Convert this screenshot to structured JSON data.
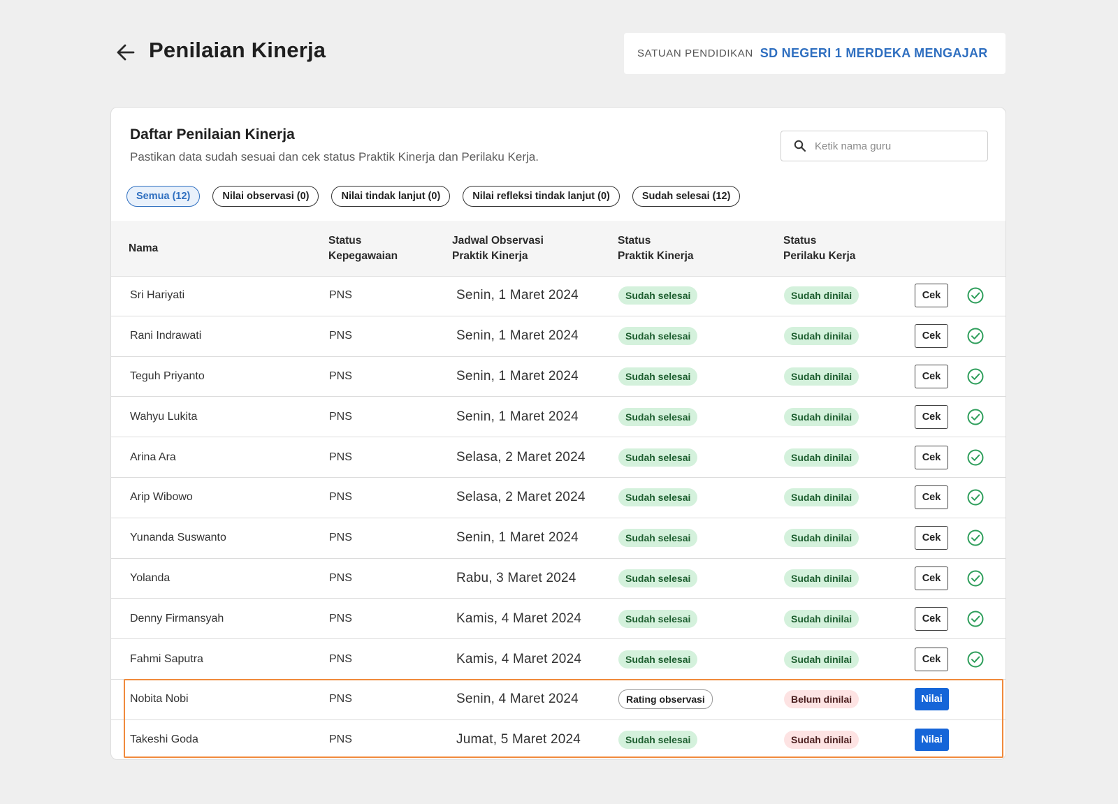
{
  "header": {
    "title": "Penilaian Kinerja",
    "school_label": "SATUAN PENDIDIKAN",
    "school_name": "SD NEGERI 1 MERDEKA MENGAJAR"
  },
  "card": {
    "title": "Daftar Penilaian Kinerja",
    "subtitle": "Pastikan data sudah sesuai dan cek status Praktik Kinerja dan Perilaku Kerja."
  },
  "search": {
    "placeholder": "Ketik nama guru"
  },
  "filters": [
    {
      "label": "Semua (12)",
      "active": true
    },
    {
      "label": "Nilai observasi (0)",
      "active": false
    },
    {
      "label": "Nilai tindak lanjut (0)",
      "active": false
    },
    {
      "label": "Nilai refleksi tindak lanjut (0)",
      "active": false
    },
    {
      "label": "Sudah selesai (12)",
      "active": false
    }
  ],
  "table": {
    "headers": {
      "nama": "Nama",
      "status_kepegawaian_1": "Status",
      "status_kepegawaian_2": "Kepegawaian",
      "jadwal_1": "Jadwal Observasi",
      "jadwal_2": "Praktik Kinerja",
      "praktik_1": "Status",
      "praktik_2": "Praktik Kinerja",
      "perilaku_1": "Status",
      "perilaku_2": "Perilaku Kerja"
    },
    "rows": [
      {
        "name": "Sri Hariyati",
        "employment": "PNS",
        "date": "Senin, 1 Maret 2024",
        "praktik": "Sudah selesai",
        "praktik_style": "green",
        "perilaku": "Sudah dinilai",
        "perilaku_style": "green",
        "action": "Cek",
        "checked": true
      },
      {
        "name": "Rani Indrawati",
        "employment": "PNS",
        "date": "Senin, 1 Maret 2024",
        "praktik": "Sudah selesai",
        "praktik_style": "green",
        "perilaku": "Sudah dinilai",
        "perilaku_style": "green",
        "action": "Cek",
        "checked": true
      },
      {
        "name": "Teguh Priyanto",
        "employment": "PNS",
        "date": "Senin, 1 Maret 2024",
        "praktik": "Sudah selesai",
        "praktik_style": "green",
        "perilaku": "Sudah dinilai",
        "perilaku_style": "green",
        "action": "Cek",
        "checked": true
      },
      {
        "name": "Wahyu Lukita",
        "employment": "PNS",
        "date": "Senin, 1 Maret 2024",
        "praktik": "Sudah selesai",
        "praktik_style": "green",
        "perilaku": "Sudah dinilai",
        "perilaku_style": "green",
        "action": "Cek",
        "checked": true
      },
      {
        "name": "Arina Ara",
        "employment": "PNS",
        "date": "Selasa, 2 Maret 2024",
        "praktik": "Sudah selesai",
        "praktik_style": "green",
        "perilaku": "Sudah dinilai",
        "perilaku_style": "green",
        "action": "Cek",
        "checked": true
      },
      {
        "name": "Arip Wibowo",
        "employment": "PNS",
        "date": "Selasa, 2 Maret 2024",
        "praktik": "Sudah selesai",
        "praktik_style": "green",
        "perilaku": "Sudah dinilai",
        "perilaku_style": "green",
        "action": "Cek",
        "checked": true
      },
      {
        "name": "Yunanda Suswanto",
        "employment": "PNS",
        "date": "Senin, 1 Maret 2024",
        "praktik": "Sudah selesai",
        "praktik_style": "green",
        "perilaku": "Sudah dinilai",
        "perilaku_style": "green",
        "action": "Cek",
        "checked": true
      },
      {
        "name": "Yolanda",
        "employment": "PNS",
        "date": "Rabu, 3 Maret 2024",
        "praktik": "Sudah selesai",
        "praktik_style": "green",
        "perilaku": "Sudah dinilai",
        "perilaku_style": "green",
        "action": "Cek",
        "checked": true
      },
      {
        "name": "Denny Firmansyah",
        "employment": "PNS",
        "date": "Kamis, 4 Maret 2024",
        "praktik": "Sudah selesai",
        "praktik_style": "green",
        "perilaku": "Sudah dinilai",
        "perilaku_style": "green",
        "action": "Cek",
        "checked": true
      },
      {
        "name": "Fahmi Saputra",
        "employment": "PNS",
        "date": "Kamis, 4 Maret 2024",
        "praktik": "Sudah selesai",
        "praktik_style": "green",
        "perilaku": "Sudah dinilai",
        "perilaku_style": "green",
        "action": "Cek",
        "checked": true
      },
      {
        "name": "Nobita Nobi",
        "employment": "PNS",
        "date": "Senin, 4 Maret 2024",
        "praktik": "Rating observasi",
        "praktik_style": "outline",
        "perilaku": "Belum dinilai",
        "perilaku_style": "red",
        "action": "Nilai",
        "checked": false
      },
      {
        "name": "Takeshi Goda",
        "employment": "PNS",
        "date": "Jumat, 5 Maret 2024",
        "praktik": "Sudah selesai",
        "praktik_style": "green",
        "perilaku": "Sudah dinilai",
        "perilaku_style": "red",
        "action": "Nilai",
        "checked": false
      }
    ]
  },
  "colors": {
    "accent": "#2f6fc0",
    "primary_button": "#1565d8",
    "success_bg": "#d4f1dc",
    "danger_bg": "#fde3e3",
    "check": "#2e9e5b",
    "highlight_border": "#f08a3c"
  },
  "icons": {
    "back": "arrow-left-icon",
    "search": "search-icon",
    "check": "check-circle-icon"
  }
}
